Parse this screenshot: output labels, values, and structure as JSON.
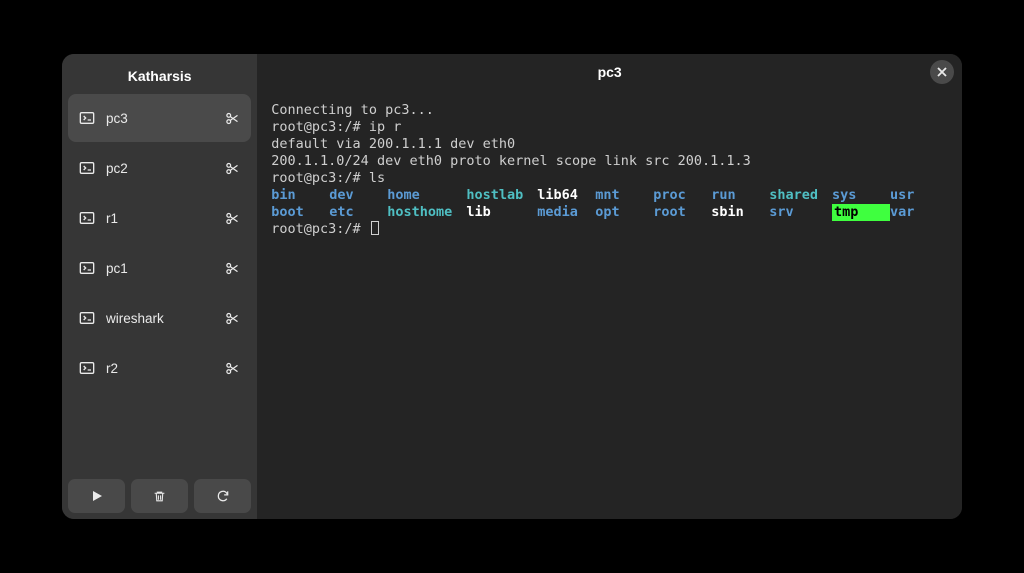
{
  "sidebar": {
    "title": "Katharsis",
    "items": [
      {
        "label": "pc3",
        "active": true
      },
      {
        "label": "pc2",
        "active": false
      },
      {
        "label": "r1",
        "active": false
      },
      {
        "label": "pc1",
        "active": false
      },
      {
        "label": "wireshark",
        "active": false
      },
      {
        "label": "r2",
        "active": false
      }
    ]
  },
  "header": {
    "title": "pc3"
  },
  "terminal": {
    "lines": [
      "Connecting to pc3...",
      "root@pc3:/# ip r",
      "default via 200.1.1.1 dev eth0",
      "200.1.1.0/24 dev eth0 proto kernel scope link src 200.1.1.3",
      "root@pc3:/# ls"
    ],
    "ls": {
      "row1": [
        {
          "text": "bin",
          "class": "c-blue"
        },
        {
          "text": "dev",
          "class": "c-blue"
        },
        {
          "text": "home",
          "class": "c-blue"
        },
        {
          "text": "hostlab",
          "class": "c-cyan"
        },
        {
          "text": "lib64",
          "class": "c-white"
        },
        {
          "text": "mnt",
          "class": "c-blue"
        },
        {
          "text": "proc",
          "class": "c-blue"
        },
        {
          "text": "run",
          "class": "c-blue"
        },
        {
          "text": "shared",
          "class": "c-cyan"
        },
        {
          "text": "sys",
          "class": "c-blue"
        },
        {
          "text": "usr",
          "class": "c-blue"
        }
      ],
      "row2": [
        {
          "text": "boot",
          "class": "c-blue"
        },
        {
          "text": "etc",
          "class": "c-blue"
        },
        {
          "text": "hosthome",
          "class": "c-cyan"
        },
        {
          "text": "lib",
          "class": "c-white"
        },
        {
          "text": "media",
          "class": "c-blue"
        },
        {
          "text": "opt",
          "class": "c-blue"
        },
        {
          "text": "root",
          "class": "c-blue"
        },
        {
          "text": "sbin",
          "class": "c-white"
        },
        {
          "text": "srv",
          "class": "c-blue"
        },
        {
          "text": "tmp",
          "class": "c-highlighted"
        },
        {
          "text": "var",
          "class": "c-blue"
        }
      ]
    },
    "prompt_after": "root@pc3:/# "
  }
}
